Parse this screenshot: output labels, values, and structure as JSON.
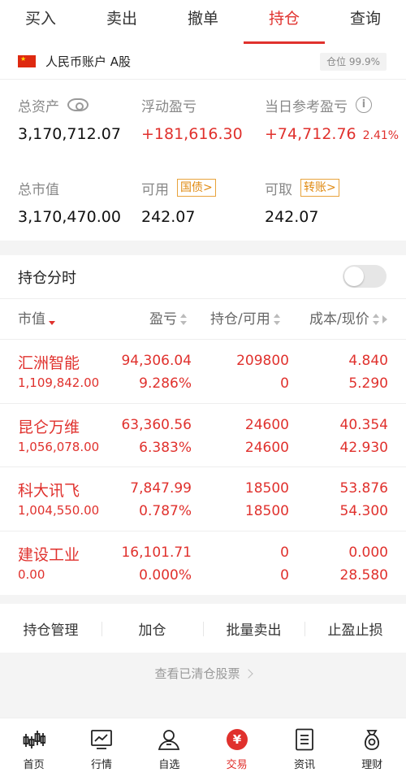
{
  "tabs": [
    "买入",
    "卖出",
    "撤单",
    "持仓",
    "查询"
  ],
  "active_tab": 3,
  "account": {
    "name": "人民币账户 A股",
    "position_ratio": "仓位 99.9%"
  },
  "summary": {
    "total_assets_label": "总资产",
    "total_assets": "3,170,712.07",
    "floating_pl_label": "浮动盈亏",
    "floating_pl": "+181,616.30",
    "today_pl_label": "当日参考盈亏",
    "today_pl": "+74,712.76",
    "today_pl_pct": "2.41%",
    "market_value_label": "总市值",
    "market_value": "3,170,470.00",
    "available_label": "可用",
    "available_tag": "国债>",
    "available": "242.07",
    "withdrawable_label": "可取",
    "withdrawable_tag": "转账>",
    "withdrawable": "242.07"
  },
  "positions_section": {
    "title": "持仓分时"
  },
  "table_header": {
    "col1": "市值",
    "col2": "盈亏",
    "col3": "持仓/可用",
    "col4": "成本/现价"
  },
  "rows": [
    {
      "name": "汇洲智能",
      "market_value": "1,109,842.00",
      "pl": "94,306.04",
      "pl_pct": "9.286%",
      "holding": "209800",
      "available": "0",
      "cost": "4.840",
      "price": "5.290"
    },
    {
      "name": "昆仑万维",
      "market_value": "1,056,078.00",
      "pl": "63,360.56",
      "pl_pct": "6.383%",
      "holding": "24600",
      "available": "24600",
      "cost": "40.354",
      "price": "42.930"
    },
    {
      "name": "科大讯飞",
      "market_value": "1,004,550.00",
      "pl": "7,847.99",
      "pl_pct": "0.787%",
      "holding": "18500",
      "available": "18500",
      "cost": "53.876",
      "price": "54.300"
    },
    {
      "name": "建设工业",
      "market_value": "0.00",
      "pl": "16,101.71",
      "pl_pct": "0.000%",
      "holding": "0",
      "available": "0",
      "cost": "0.000",
      "price": "28.580"
    }
  ],
  "actions": [
    "持仓管理",
    "加仓",
    "批量卖出",
    "止盈止损"
  ],
  "cleared_link": "查看已清仓股票",
  "bottom_nav": [
    "首页",
    "行情",
    "自选",
    "交易",
    "资讯",
    "理财"
  ],
  "colors": {
    "accent": "#e0312d",
    "tag": "#e08a12"
  }
}
